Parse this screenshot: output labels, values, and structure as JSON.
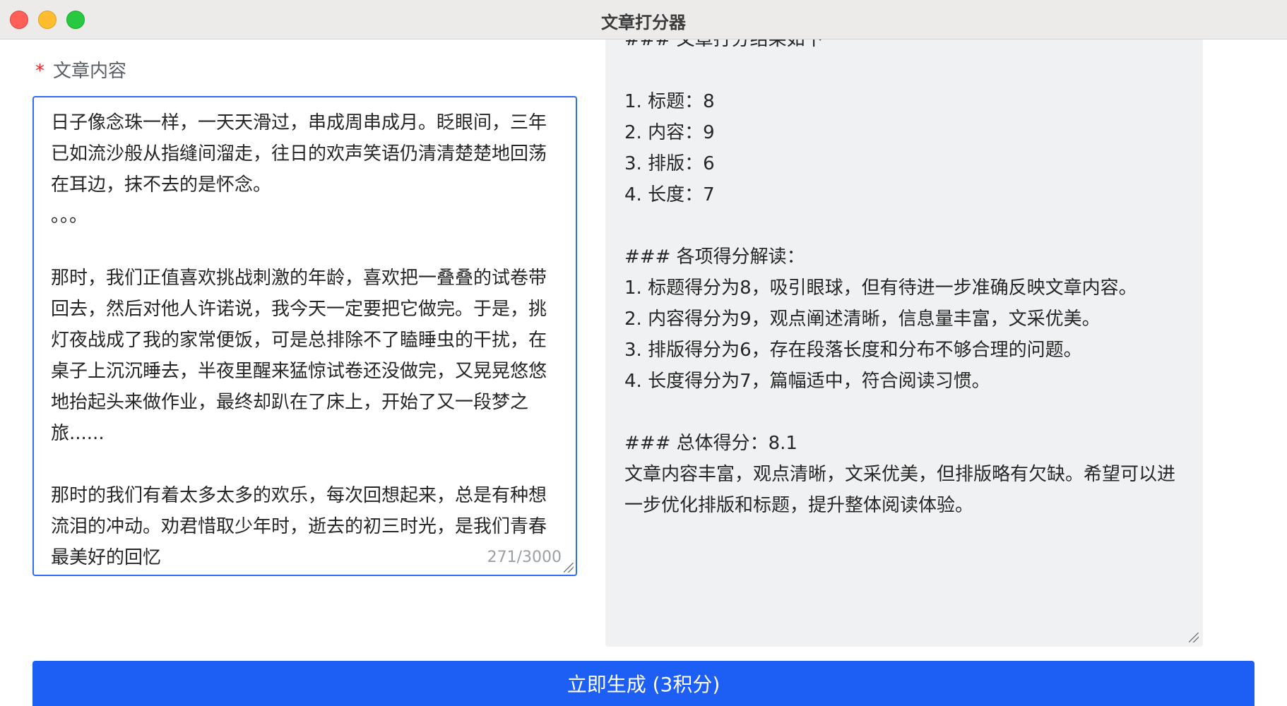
{
  "window": {
    "title": "文章打分器"
  },
  "form": {
    "required_mark": "*",
    "label": "文章内容",
    "article_text": "日子像念珠一样，一天天滑过，串成周串成月。眨眼间，三年已如流沙般从指缝间溜走，往日的欢声笑语仍清清楚楚地回荡在耳边，抹不去的是怀念。\n。。。\n\n那时，我们正值喜欢挑战刺激的年龄，喜欢把一叠叠的试卷带回去，然后对他人许诺说，我今天一定要把它做完。于是，挑灯夜战成了我的家常便饭，可是总排除不了瞌睡虫的干扰，在桌子上沉沉睡去，半夜里醒来猛惊试卷还没做完，又晃晃悠悠地抬起头来做作业，最终却趴在了床上，开始了又一段梦之旅......\n\n那时的我们有着太多太多的欢乐，每次回想起来，总是有种想流泪的冲动。劝君惜取少年时，逝去的初三时光，是我们青春最美好的回忆",
    "char_count": "271/3000"
  },
  "result": {
    "text": "### 文章打分结果如下\n\n1. 标题：8\n2. 内容：9\n3. 排版：6\n4. 长度：7\n\n### 各项得分解读：\n1. 标题得分为8，吸引眼球，但有待进一步准确反映文章内容。\n2. 内容得分为9，观点阐述清晰，信息量丰富，文采优美。\n3. 排版得分为6，存在段落长度和分布不够合理的问题。\n4. 长度得分为7，篇幅适中，符合阅读习惯。\n\n### 总体得分：8.1\n文章内容丰富，观点清晰，文采优美，但排版略有欠缺。希望可以进一步优化排版和标题，提升整体阅读体验。"
  },
  "actions": {
    "generate_label": "立即生成 (3积分)"
  },
  "colors": {
    "accent": "#1d5ff5",
    "editor_border": "#2f6bf6",
    "required": "#f5222d",
    "panel_bg": "#f0f1f3"
  }
}
